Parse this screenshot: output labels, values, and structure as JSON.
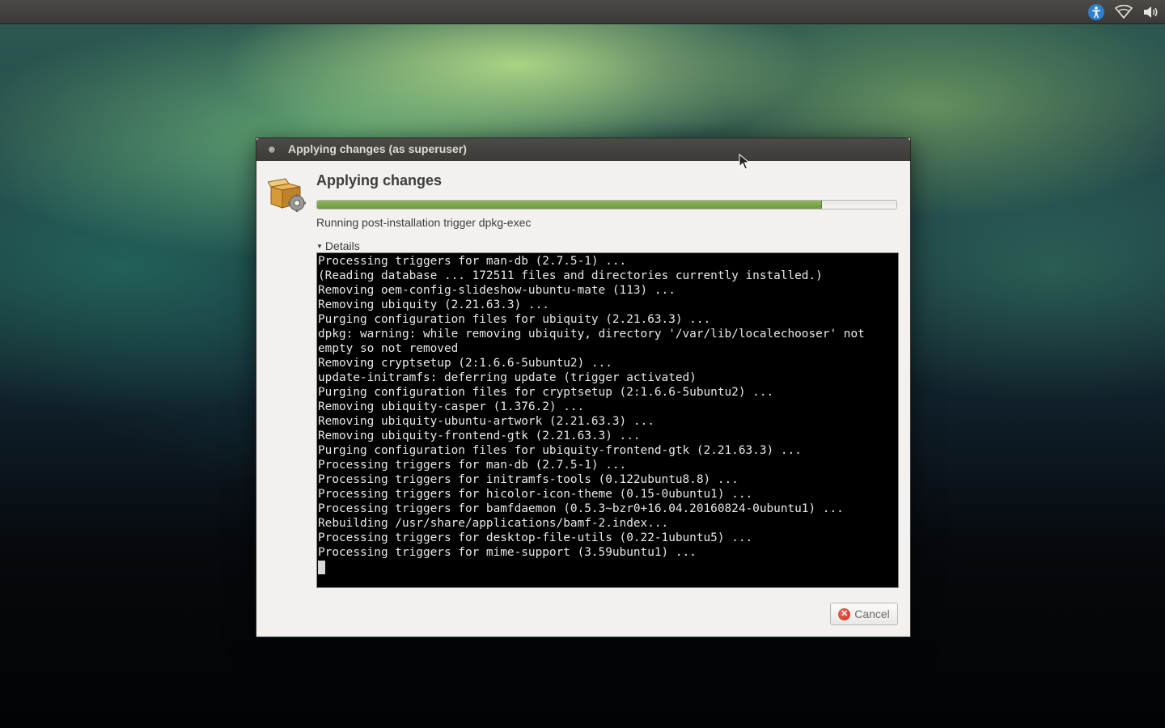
{
  "topbar": {
    "tray_icons": [
      "accessibility-icon",
      "wifi-icon",
      "volume-icon"
    ]
  },
  "window": {
    "title": "Applying changes (as superuser)",
    "heading": "Applying changes",
    "progress_fraction": 0.87,
    "status": "Running post-installation trigger dpkg-exec",
    "details_label": "Details",
    "terminal_lines": [
      "Processing triggers for man-db (2.7.5-1) ...",
      "(Reading database ... 172511 files and directories currently installed.)",
      "Removing oem-config-slideshow-ubuntu-mate (113) ...",
      "Removing ubiquity (2.21.63.3) ...",
      "Purging configuration files for ubiquity (2.21.63.3) ...",
      "dpkg: warning: while removing ubiquity, directory '/var/lib/localechooser' not",
      "empty so not removed",
      "Removing cryptsetup (2:1.6.6-5ubuntu2) ...",
      "update-initramfs: deferring update (trigger activated)",
      "Purging configuration files for cryptsetup (2:1.6.6-5ubuntu2) ...",
      "Removing ubiquity-casper (1.376.2) ...",
      "Removing ubiquity-ubuntu-artwork (2.21.63.3) ...",
      "Removing ubiquity-frontend-gtk (2.21.63.3) ...",
      "Purging configuration files for ubiquity-frontend-gtk (2.21.63.3) ...",
      "Processing triggers for man-db (2.7.5-1) ...",
      "Processing triggers for initramfs-tools (0.122ubuntu8.8) ...",
      "Processing triggers for hicolor-icon-theme (0.15-0ubuntu1) ...",
      "Processing triggers for bamfdaemon (0.5.3~bzr0+16.04.20160824-0ubuntu1) ...",
      "Rebuilding /usr/share/applications/bamf-2.index...",
      "Processing triggers for desktop-file-utils (0.22-1ubuntu5) ...",
      "Processing triggers for mime-support (3.59ubuntu1) ..."
    ],
    "cancel_label": "Cancel"
  },
  "colors": {
    "progress_fill": "#7aa64a",
    "accessibility_blue": "#2f7fd0",
    "cancel_red": "#d8352a"
  }
}
